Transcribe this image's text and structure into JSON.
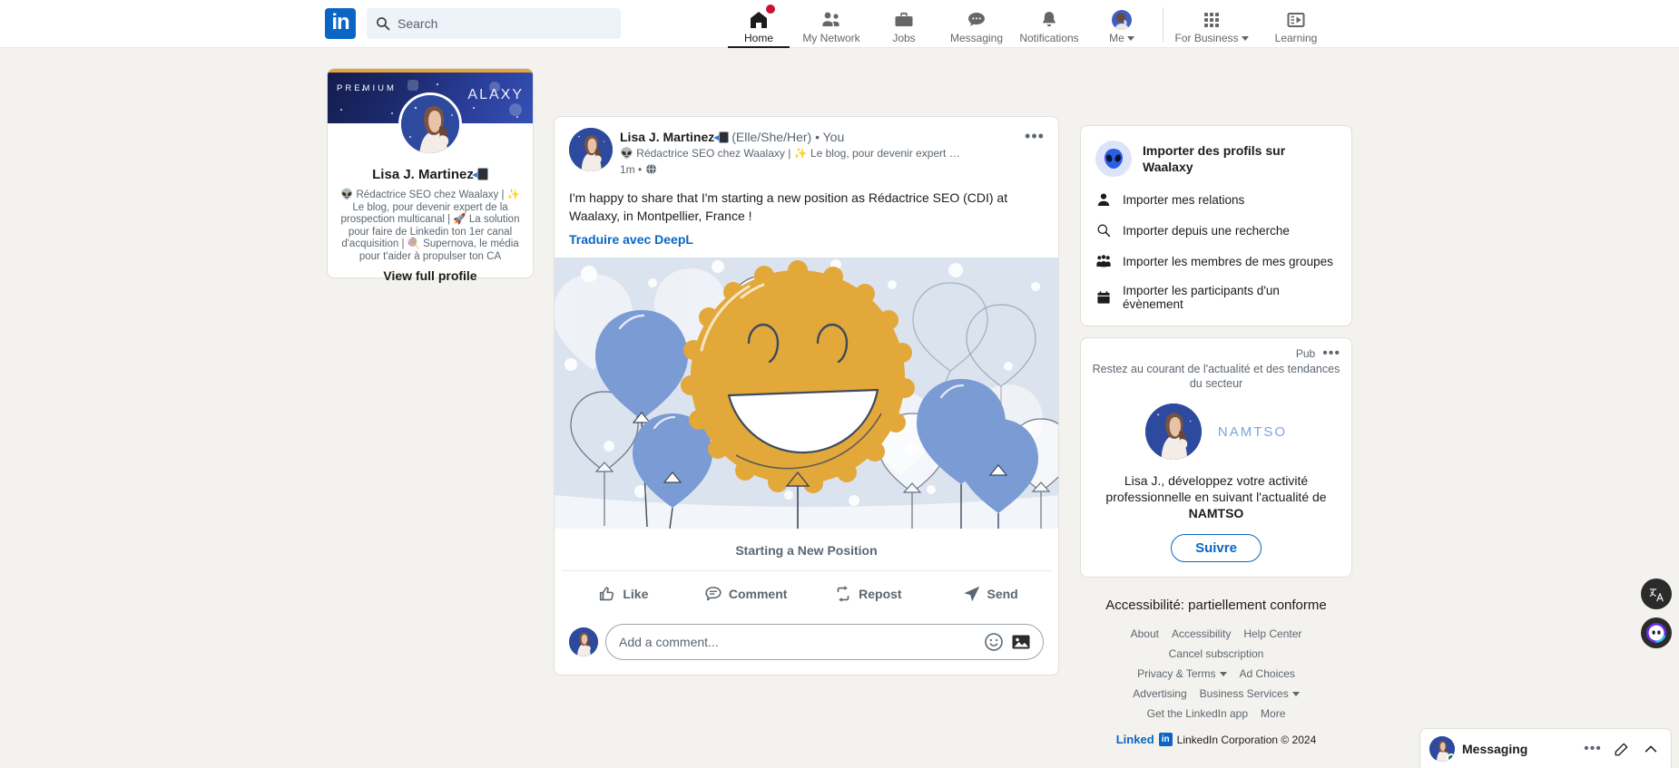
{
  "topnav": {
    "logo": "in",
    "search": {
      "placeholder": "Search",
      "value": "",
      "icon": "search-icon"
    },
    "items": [
      {
        "label": "Home",
        "icon": "home-icon",
        "active": true,
        "badge": true
      },
      {
        "label": "My Network",
        "icon": "people-icon",
        "active": false,
        "badge": false
      },
      {
        "label": "Jobs",
        "icon": "briefcase-icon",
        "active": false,
        "badge": false
      },
      {
        "label": "Messaging",
        "icon": "speech-bubble-icon",
        "active": false,
        "badge": false
      },
      {
        "label": "Notifications",
        "icon": "bell-icon",
        "active": false,
        "badge": false
      },
      {
        "label": "Me",
        "icon": "avatar-icon",
        "active": false,
        "caret": true
      },
      {
        "label": "For Business",
        "icon": "grid-icon",
        "active": false,
        "caret": true
      },
      {
        "label": "Learning",
        "icon": "learning-icon",
        "active": false,
        "caret": false
      }
    ]
  },
  "profile_card": {
    "premium_label": "PREMIUM",
    "cover_brand": "ALAXY",
    "name": "Lisa J. Martinez",
    "headline": "👽 Rédactrice SEO chez Waalaxy | ✨ Le blog, pour devenir expert de la prospection multicanal | 🚀 La solution pour faire de Linkedin ton 1er canal d'acquisition | 🍭 Supernova, le média pour t'aider à propulser ton CA",
    "view_profile_label": "View full profile"
  },
  "post": {
    "author_name": "Lisa J. Martinez",
    "pronouns": "(Elle/She/Her)",
    "you_label": "You",
    "separator": "•",
    "headline": "👽 Rédactrice SEO chez Waalaxy | ✨ Le blog, pour devenir expert …",
    "time": "1m",
    "visibility_icon": "globe-icon",
    "menu_icon": "more-options-icon",
    "body": "I'm happy to share that I'm starting a new position as Rédactrice SEO (CDI) at Waalaxy, in Montpellier, France !",
    "translate_label": "Traduire avec DeepL",
    "image_caption": "Starting a New Position",
    "actions": [
      {
        "label": "Like",
        "icon": "thumbs-up-icon"
      },
      {
        "label": "Comment",
        "icon": "comment-bubble-icon"
      },
      {
        "label": "Repost",
        "icon": "repost-icon"
      },
      {
        "label": "Send",
        "icon": "send-icon"
      }
    ],
    "comment": {
      "placeholder": "Add a comment...",
      "value": "",
      "emoji_icon": "emoji-icon",
      "image_icon": "image-icon"
    }
  },
  "waalaxy_card": {
    "avatar_icon": "alien-icon",
    "title": "Importer des profils sur Waalaxy",
    "items": [
      {
        "label": "Importer mes relations",
        "icon": "person-icon"
      },
      {
        "label": "Importer depuis une recherche",
        "icon": "search-icon"
      },
      {
        "label": "Importer les membres de mes groupes",
        "icon": "group-icon"
      },
      {
        "label": "Importer les participants d'un évènement",
        "icon": "calendar-icon"
      }
    ]
  },
  "ad_card": {
    "pub_label": "Pub",
    "menu_icon": "more-options-icon",
    "tagline": "Restez au courant de l'actualité et des tendances du secteur",
    "brand": "NAMTSO",
    "copy_prefix": "Lisa J., développez votre activité professionnelle en suivant l'actualité de ",
    "copy_brand": "NAMTSO",
    "follow_label": "Suivre"
  },
  "footer": {
    "accessibility_line": "Accessibilité: partiellement conforme",
    "rows": [
      [
        {
          "label": "About"
        },
        {
          "label": "Accessibility"
        },
        {
          "label": "Help Center"
        }
      ],
      [
        {
          "label": "Cancel subscription"
        }
      ],
      [
        {
          "label": "Privacy & Terms",
          "caret": true
        },
        {
          "label": "Ad Choices"
        }
      ],
      [
        {
          "label": "Advertising"
        },
        {
          "label": "Business Services",
          "caret": true
        }
      ],
      [
        {
          "label": "Get the LinkedIn app"
        },
        {
          "label": "More"
        }
      ]
    ],
    "copyright_word": "Linked",
    "copyright_mark": "in",
    "copyright_text": "LinkedIn Corporation © 2024"
  },
  "fabs": [
    {
      "name": "translate-fab",
      "icon": "translate-icon"
    },
    {
      "name": "waalaxy-fab",
      "icon": "alien-icon"
    }
  ],
  "messaging": {
    "title": "Messaging",
    "menu_icon": "more-options-icon",
    "compose_icon": "compose-icon",
    "expand_icon": "chevron-up-icon"
  },
  "colors": {
    "brand_blue": "#0a66c2",
    "page_bg": "#f4f2ee",
    "premium_gold": "#e7a33e",
    "notification_red": "#cb112d",
    "balloon_blue": "#7b9bd4",
    "balloon_gold": "#e3a83a",
    "illustration_bg": "#dbe3ef"
  }
}
